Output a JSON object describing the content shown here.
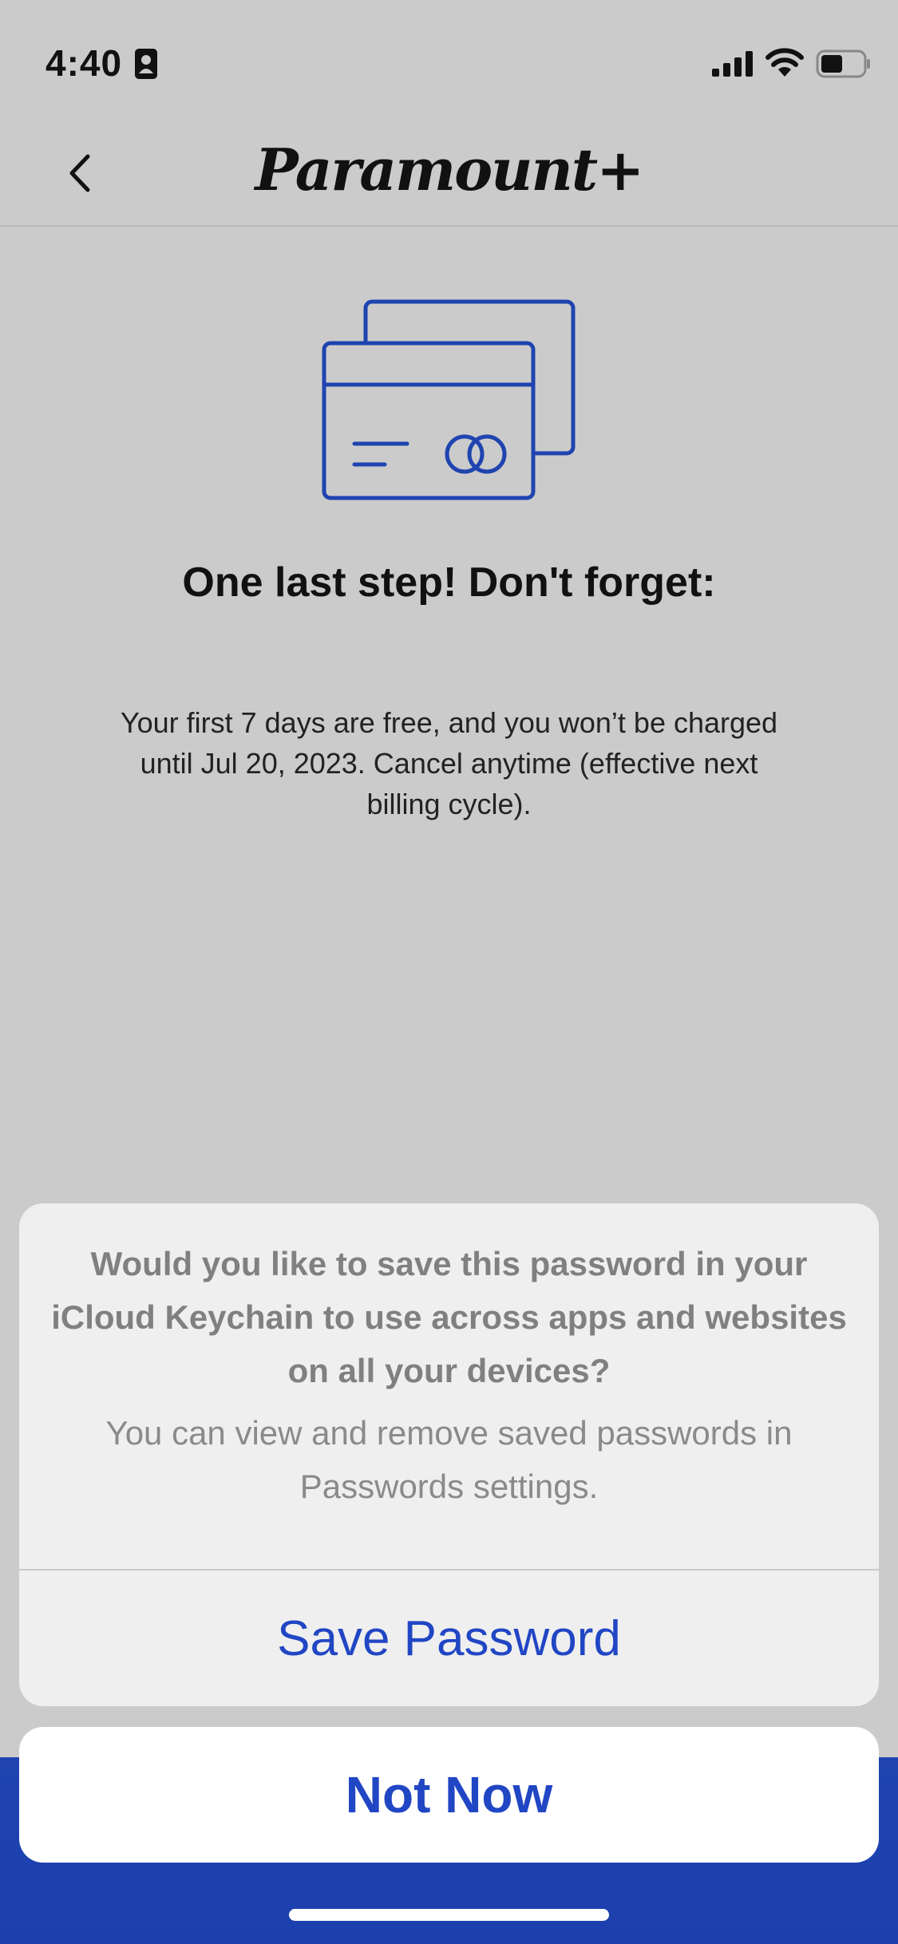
{
  "status_bar": {
    "time": "4:40",
    "icons": [
      "contact-card-icon",
      "signal-icon",
      "wifi-icon",
      "battery-icon"
    ]
  },
  "nav": {
    "back_icon": "chevron-left-icon",
    "brand": "Paramount+"
  },
  "main": {
    "illustration": "credit-cards-icon",
    "headline": "One last step! Don't forget:",
    "trial_text": "Your first 7 days are free, and you won’t be charged until Jul 20, 2023. Cancel anytime (effective next billing cycle)."
  },
  "keychain_alert": {
    "message": "Would you like to save this password in your iCloud Keychain to use across apps and websites on all your devices?",
    "detail": "You can view and remove saved passwords in Passwords settings.",
    "save_label": "Save Password",
    "dismiss_label": "Not Now"
  },
  "colors": {
    "accent": "#2146c4",
    "background": "#cbcbcb",
    "sheet": "#efefef",
    "brand_blue": "#1f44b0"
  }
}
